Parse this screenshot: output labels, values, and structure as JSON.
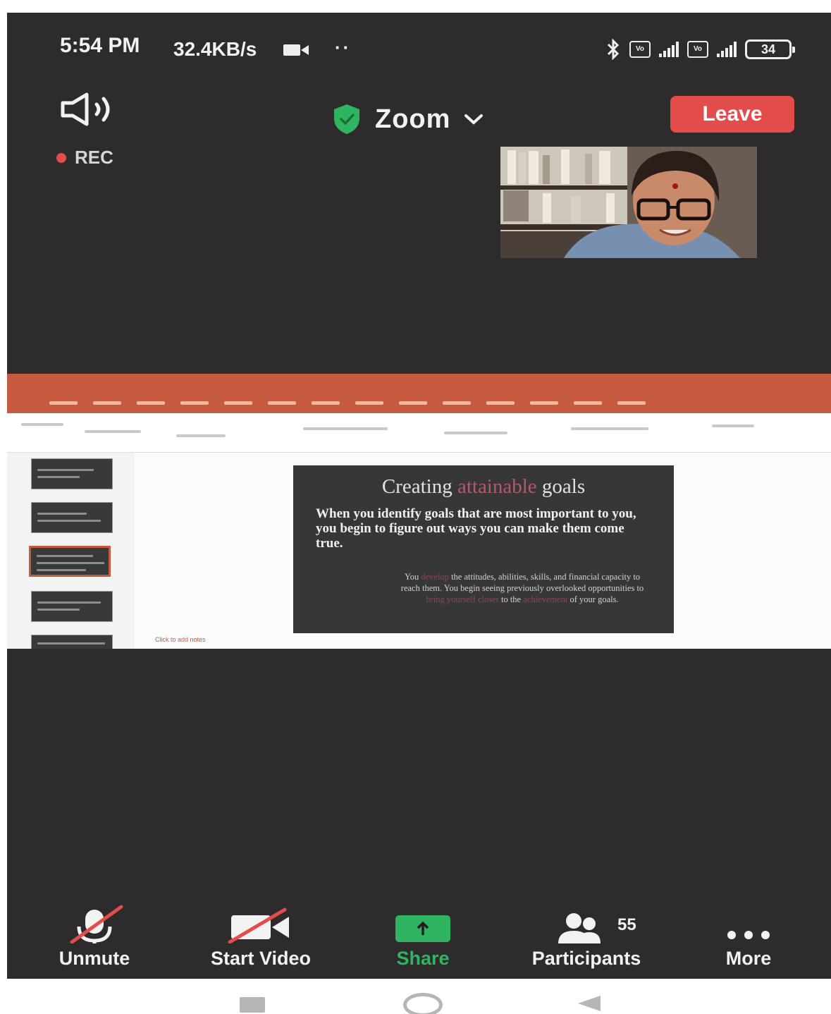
{
  "status_bar": {
    "time": "5:54 PM",
    "network_speed": "32.4KB/s",
    "overflow_dots": "··",
    "battery_level": "34"
  },
  "header": {
    "meeting_title": "Zoom",
    "leave_label": "Leave",
    "recording_label": "REC"
  },
  "slide": {
    "title_before": "Creating",
    "title_highlight": "attainable",
    "title_after": "goals",
    "body": "When you identify goals that are most important to you, you begin to figure out ways you can make them come true.",
    "sub_1": "You",
    "sub_2": "develop",
    "sub_3": "the attitudes, abilities, skills, and financial capacity to reach them. You begin seeing previously overlooked opportunities to",
    "sub_4": "bring yourself closer",
    "sub_5": "to the",
    "sub_6": "achievement",
    "sub_7": "of your goals.",
    "notes_placeholder": "Click to add notes"
  },
  "controls": {
    "unmute_label": "Unmute",
    "start_video_label": "Start Video",
    "share_label": "Share",
    "participants_label": "Participants",
    "participants_count": "55",
    "more_label": "More"
  },
  "colors": {
    "leave_red": "#e24c4b",
    "share_green": "#2fb561",
    "shield_green": "#2fb561",
    "ppt_orange": "#c65a3e",
    "background_dark": "#2d2b2c"
  }
}
